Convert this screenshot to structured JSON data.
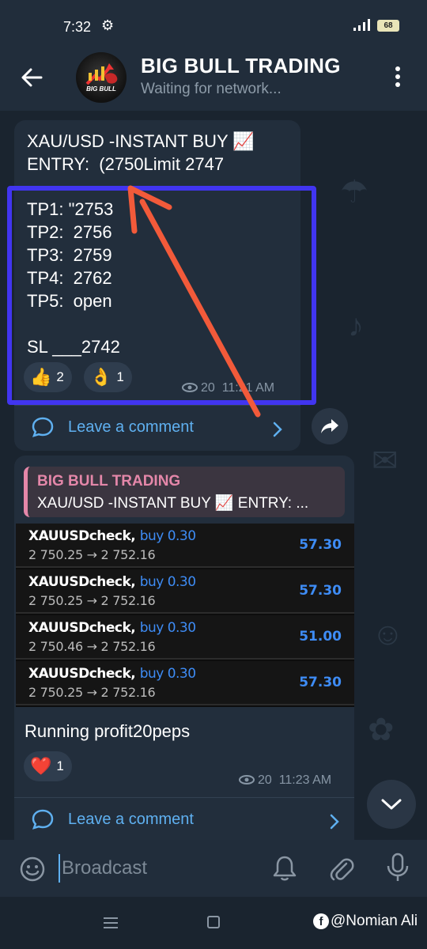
{
  "status_bar": {
    "time": "7:32",
    "battery": "68"
  },
  "header": {
    "channel_title": "BIG BULL TRADING",
    "channel_status": "Waiting for network...",
    "avatar_text": "BIG BULL"
  },
  "message1": {
    "entry_text": "XAU/USD -INSTANT BUY 📈\nENTRY:  (2750Limit 2747",
    "targets_text": "TP1: \"2753\nTP2:  2756\nTP3:  2759\nTP4:  2762\nTP5:  open\n\nSL ___2742",
    "reactions": [
      {
        "emoji": "👍",
        "count": "2"
      },
      {
        "emoji": "👌",
        "count": "1"
      }
    ],
    "views": "20",
    "time": "11:21 AM",
    "comment_label": "Leave a comment"
  },
  "message2": {
    "reply_author": "BIG BULL TRADING",
    "reply_snippet": "XAU/USD -INSTANT BUY 📈     ENTRY: ...",
    "trades": [
      {
        "symbol": "XAUUSDcheck,",
        "side": "buy 0.30",
        "prices": "2 750.25 → 2 752.16",
        "profit": "57.30"
      },
      {
        "symbol": "XAUUSDcheck,",
        "side": "buy 0.30",
        "prices": "2 750.25 → 2 752.16",
        "profit": "57.30"
      },
      {
        "symbol": "XAUUSDcheck,",
        "side": "buy 0.30",
        "prices": "2 750.46 → 2 752.16",
        "profit": "51.00"
      },
      {
        "symbol": "XAUUSDcheck,",
        "side": "buy 0.30",
        "prices": "2 750.25 → 2 752.16",
        "profit": "57.30"
      }
    ],
    "text": "Running profit20peps",
    "reaction": {
      "emoji": "❤️",
      "count": "1"
    },
    "views": "20",
    "time": "11:23 AM",
    "comment_label": "Leave a comment"
  },
  "input_bar": {
    "placeholder": "Broadcast"
  },
  "watermark": "@Nomian Ali",
  "colors": {
    "accent": "#5fb0f0",
    "highlight_box": "#4135f0",
    "arrow": "#f25a3a",
    "quote": "#e487a9"
  }
}
